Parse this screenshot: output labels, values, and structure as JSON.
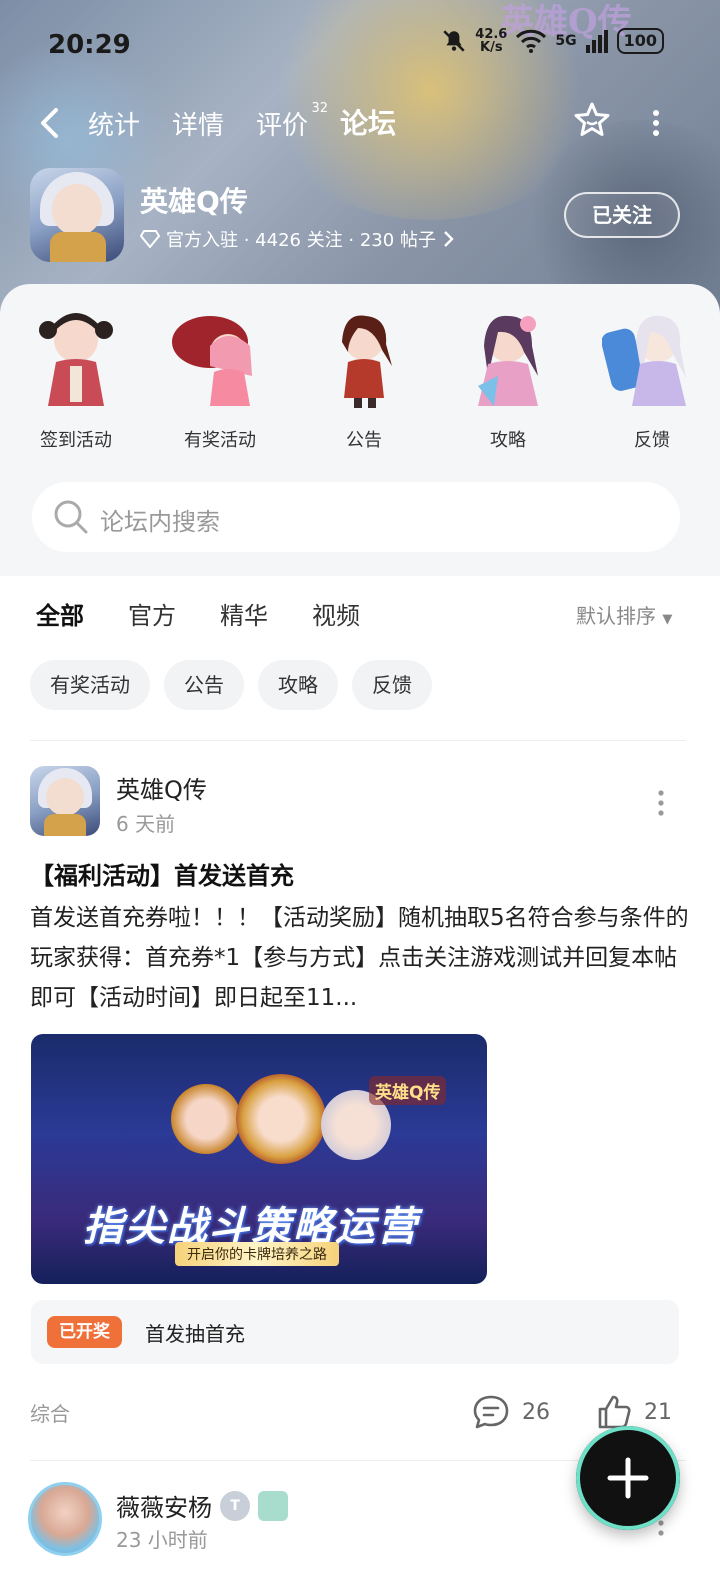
{
  "status_bar": {
    "time": "20:29",
    "speed_value": "42.6",
    "speed_unit": "K/s",
    "network": "5G",
    "battery": "100"
  },
  "hero": {
    "brand_text": "英雄Q传"
  },
  "nav": {
    "tabs": [
      {
        "label": "统计"
      },
      {
        "label": "详情"
      },
      {
        "label": "评价",
        "badge": "32"
      },
      {
        "label": "论坛",
        "active": true
      }
    ],
    "icons": [
      "back-icon",
      "star-icon",
      "more-icon"
    ]
  },
  "game": {
    "name": "英雄Q传",
    "meta": "官方入驻 · 4426 关注 · 230 帖子",
    "follow_label": "已关注"
  },
  "quick_links": [
    {
      "label": "签到活动"
    },
    {
      "label": "有奖活动"
    },
    {
      "label": "公告"
    },
    {
      "label": "攻略"
    },
    {
      "label": "反馈"
    }
  ],
  "search": {
    "placeholder": "论坛内搜索"
  },
  "feed_tabs": [
    {
      "label": "全部",
      "active": true
    },
    {
      "label": "官方"
    },
    {
      "label": "精华"
    },
    {
      "label": "视频"
    }
  ],
  "sort_label": "默认排序",
  "chips": [
    {
      "label": "有奖活动"
    },
    {
      "label": "公告"
    },
    {
      "label": "攻略"
    },
    {
      "label": "反馈"
    }
  ],
  "post1": {
    "author": "英雄Q传",
    "time": "6 天前",
    "title": "【福利活动】首发送首充",
    "body": "首发送首充券啦！！！【活动奖励】随机抽取5名符合参与条件的玩家获得：首充券*1【参与方式】点击关注游戏测试并回复本帖即可【活动时间】即日起至11...",
    "image": {
      "logo": "英雄Q传",
      "slogan": "指尖战斗策略运营",
      "subtitle": "开启你的卡牌培养之路"
    },
    "lottery_tag": "已开奖",
    "lottery_text": "首发抽首充",
    "category": "综合",
    "comments": "26",
    "likes": "21"
  },
  "post2": {
    "author": "薇薇安杨",
    "level": "T",
    "time": "23 小时前"
  },
  "colors": {
    "accent": "#3fd0b0",
    "lottery_tag": "#f0703a"
  }
}
